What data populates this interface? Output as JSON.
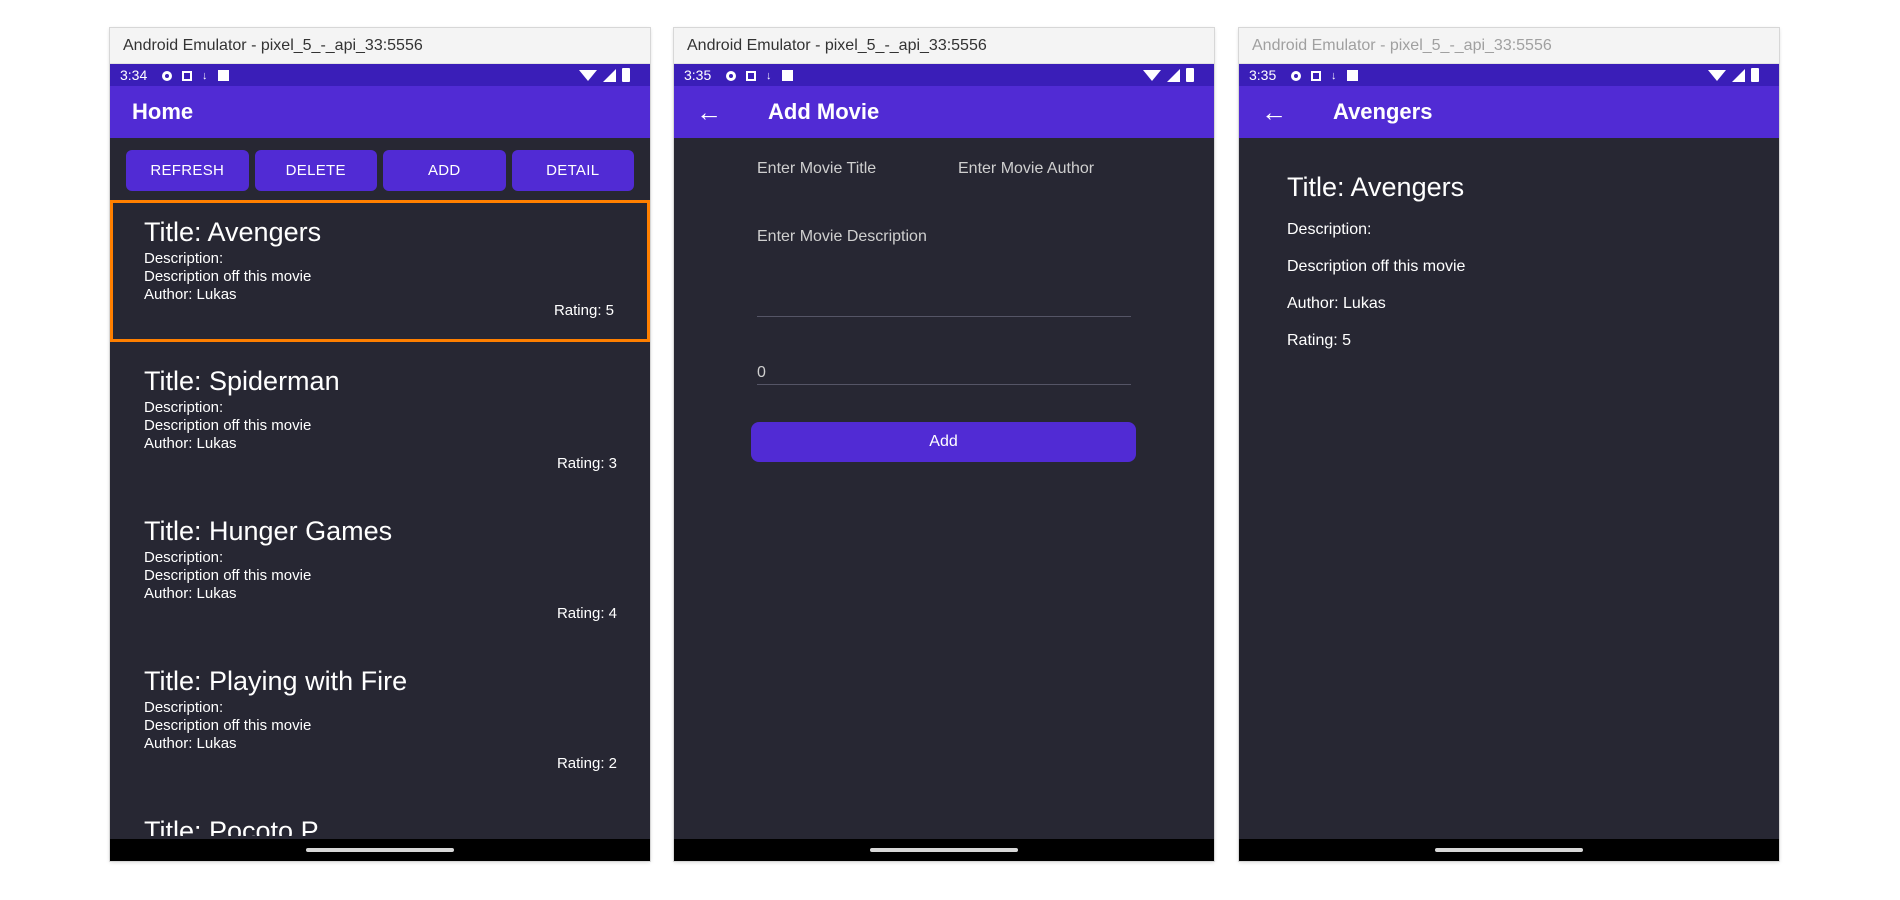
{
  "window_title": "Android Emulator - pixel_5_-_api_33:5556",
  "screen1": {
    "time": "3:34",
    "app_title": "Home",
    "buttons": [
      "REFRESH",
      "DELETE",
      "ADD",
      "DETAIL"
    ],
    "movies": [
      {
        "title": "Title: Avengers",
        "description_label": "Description:",
        "description": "Description off this movie",
        "author": "Author: Lukas",
        "rating": "Rating: 5"
      },
      {
        "title": "Title: Spiderman",
        "description_label": "Description:",
        "description": "Description off this movie",
        "author": "Author: Lukas",
        "rating": "Rating: 3"
      },
      {
        "title": "Title: Hunger Games",
        "description_label": "Description:",
        "description": "Description off this movie",
        "author": "Author: Lukas",
        "rating": "Rating: 4"
      },
      {
        "title": "Title: Playing with Fire",
        "description_label": "Description:",
        "description": "Description off this movie",
        "author": "Author: Lukas",
        "rating": "Rating: 2"
      },
      {
        "title": "Title: Pocoto P..."
      }
    ]
  },
  "screen2": {
    "time": "3:35",
    "app_title": "Add Movie",
    "title_placeholder": "Enter Movie Title",
    "author_placeholder": "Enter Movie Author",
    "description_placeholder": "Enter Movie Description",
    "rating_value": "0",
    "add_button": "Add"
  },
  "screen3": {
    "time": "3:35",
    "app_title": "Avengers",
    "title": "Title: Avengers",
    "description_label": "Description:",
    "description": "Description off this movie",
    "author": "Author: Lukas",
    "rating": "Rating: 5"
  },
  "icons": {
    "back": "arrow-left-icon",
    "status": [
      "gear-icon",
      "square-icon",
      "download-icon",
      "sd-card-icon",
      "wifi-icon",
      "signal-icon",
      "battery-icon"
    ]
  },
  "colors": {
    "status_bar": "#3a1eb8",
    "app_bar": "#512bd4",
    "background": "#272733",
    "selection": "#ff7f00"
  }
}
